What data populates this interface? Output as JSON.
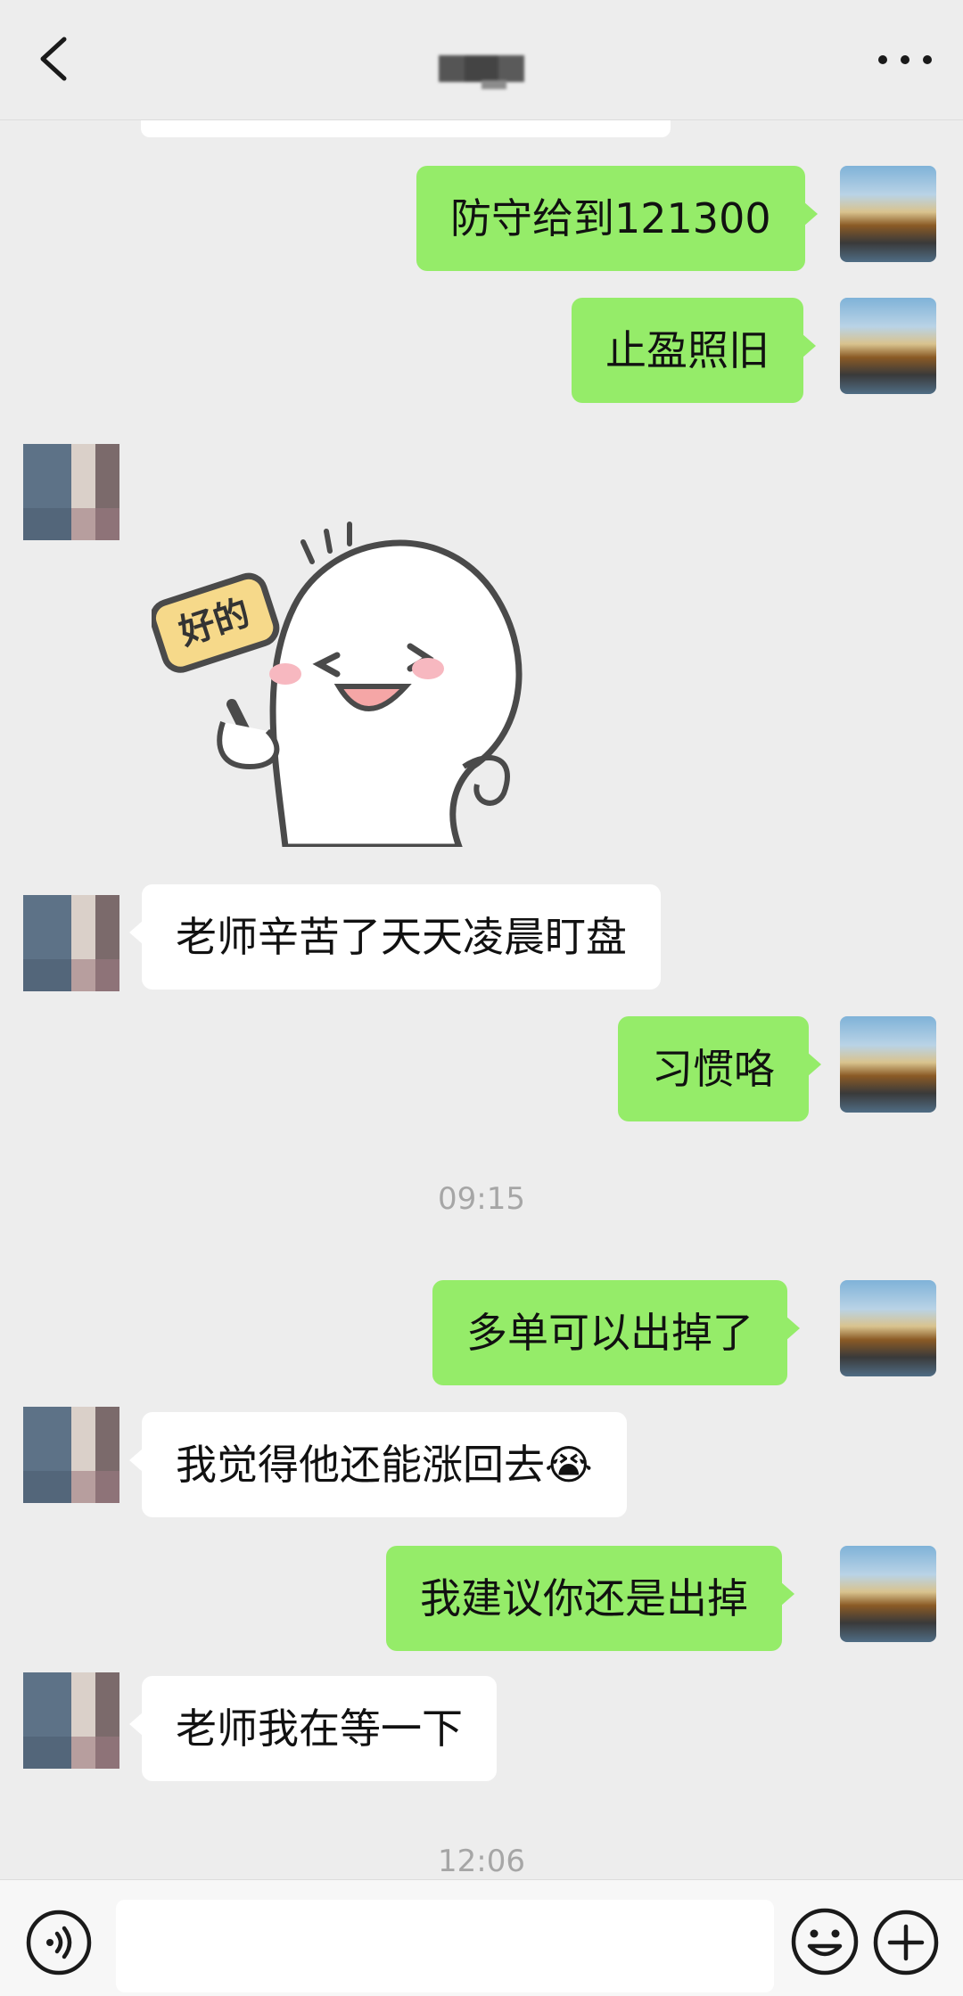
{
  "header": {
    "title": "",
    "back_icon": "chevron-left-icon",
    "more_icon": "more-dots-icon"
  },
  "messages": [
    {
      "from": "me",
      "text": "防守给到121300"
    },
    {
      "from": "me",
      "text": "止盈照旧"
    },
    {
      "from": "them",
      "sticker": "ok-sticker",
      "sticker_text": "好的"
    },
    {
      "from": "them",
      "text": "老师辛苦了天天凌晨盯盘"
    },
    {
      "from": "me",
      "text": "习惯咯"
    },
    {
      "timestamp": "09:15"
    },
    {
      "from": "me",
      "text": "多单可以出掉了"
    },
    {
      "from": "them",
      "text": "我觉得他还能涨回去",
      "emoji": "😭"
    },
    {
      "from": "me",
      "text": "我建议你还是出掉"
    },
    {
      "from": "them",
      "text": "老师我在等一下"
    },
    {
      "timestamp": "12:06"
    }
  ],
  "input": {
    "value": "",
    "voice_icon": "voice-icon",
    "emoji_icon": "emoji-icon",
    "plus_icon": "plus-icon"
  },
  "colors": {
    "background": "#ededed",
    "me_bubble": "#95ec69",
    "them_bubble": "#ffffff",
    "timestamp": "#a6a6a6"
  }
}
